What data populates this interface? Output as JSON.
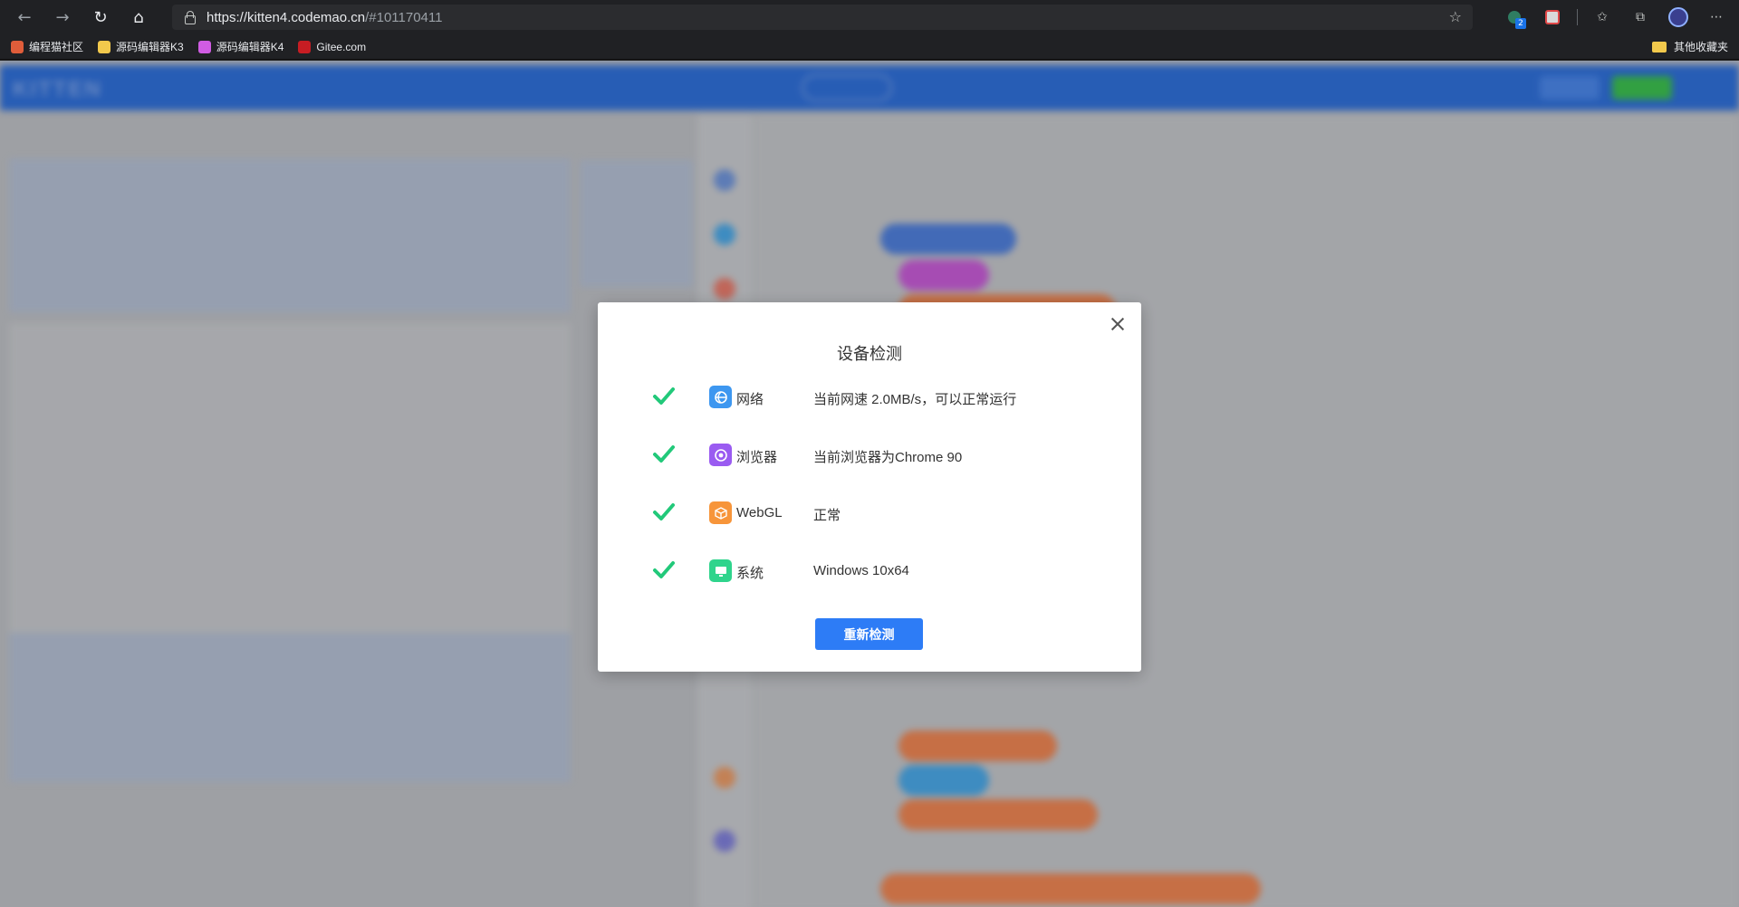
{
  "browser": {
    "url_host": "https://kitten4.codemao.cn",
    "url_rest": "/#101170411",
    "extension_badge": "2",
    "bookmarks": [
      {
        "label": "编程猫社区",
        "icon_color": "#e05d3a"
      },
      {
        "label": "源码编辑器K3",
        "icon_color": "#f2c94c"
      },
      {
        "label": "源码编辑器K4",
        "icon_color": "#d05ce3"
      },
      {
        "label": "Gitee.com",
        "icon_color": "#c71d23"
      }
    ],
    "other_bookmarks": "其他收藏夹"
  },
  "dialog": {
    "title": "设备检测",
    "items": [
      {
        "icon": "network-icon",
        "icon_color": "#3d97f0",
        "label": "网络",
        "value": "当前网速 2.0MB/s，可以正常运行",
        "status": "ok"
      },
      {
        "icon": "browser-icon",
        "icon_color": "#9a5bf1",
        "label": "浏览器",
        "value": "当前浏览器为Chrome 90",
        "status": "ok"
      },
      {
        "icon": "webgl-icon",
        "icon_color": "#f7953a",
        "label": "WebGL",
        "value": "正常",
        "status": "ok"
      },
      {
        "icon": "system-icon",
        "icon_color": "#2fd48c",
        "label": "系统",
        "value": "Windows 10x64",
        "status": "ok"
      }
    ],
    "retest_button": "重新检测",
    "check_color": "#22c97a"
  }
}
